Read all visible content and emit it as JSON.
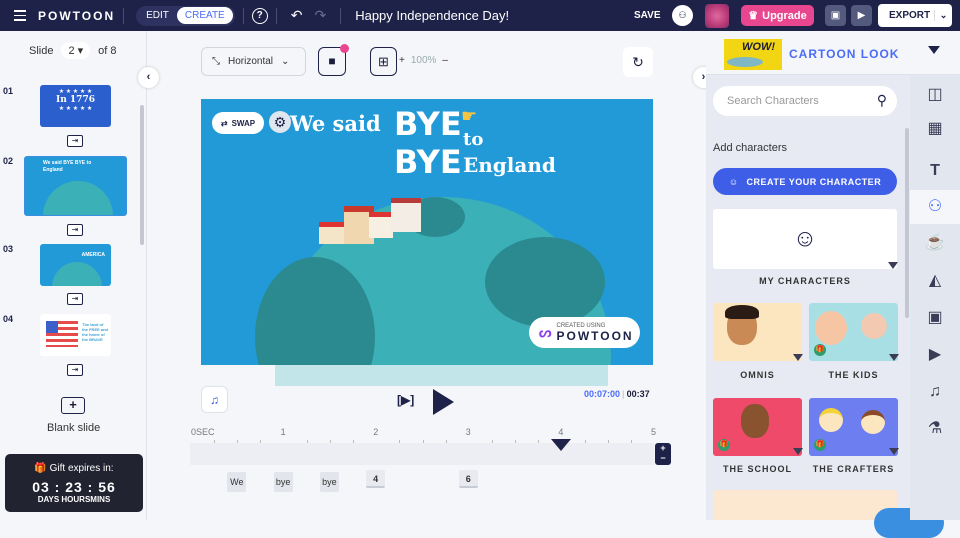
{
  "topbar": {
    "logo": "POWTOON",
    "modes": [
      "EDIT",
      "CREATE"
    ],
    "active_mode": "CREATE",
    "help_icon": "?",
    "undo_icon": "↶",
    "redo_icon": "↷",
    "title": "Happy Independence Day!",
    "save_label": "SAVE",
    "add_user_icon": "person-plus",
    "upgrade_label": "Upgrade",
    "upgrade_icon": "♛",
    "presentation_icon": "▣",
    "play_icon": "▶",
    "export_label": "EXPORT",
    "export_dropdown_icon": "⌄",
    "colors": {
      "bar": "#1e2248",
      "upgrade": "#e8468f",
      "accent": "#4a6cf7"
    }
  },
  "slides_panel": {
    "slide_label": "Slide",
    "current_slide": "2",
    "of_label": "of 8",
    "slides": [
      {
        "number": "01",
        "title": "In 1776"
      },
      {
        "number": "02",
        "title": "We said BYE BYE to England"
      },
      {
        "number": "03",
        "title": "AMERICA"
      },
      {
        "number": "04",
        "title": "The land of the FREE and the home of the BRAVE"
      }
    ],
    "transition_icon": "⇥",
    "blank_slide_icon": "+",
    "blank_slide_label": "Blank slide",
    "gift": {
      "label": "Gift expires in:",
      "countdown": "03 : 23 : 56",
      "units": "DAYS HOURSMINS"
    }
  },
  "canvas_toolbar": {
    "orientation": "Horizontal",
    "zoom_plus": "+",
    "zoom_level": "100%",
    "zoom_minus": "–"
  },
  "slide": {
    "swap_label": "SWAP",
    "line1": "We said",
    "bye1": "BYE",
    "bye2": "BYE",
    "to": "to",
    "england": "England",
    "created_using": "CREATED USING",
    "brand": "POWTOON"
  },
  "playback": {
    "preview_label": "[▶]",
    "current_time": "00:07:00",
    "total_time": "00:37"
  },
  "timeline": {
    "ticks": [
      "0SEC",
      "1",
      "2",
      "3",
      "4",
      "5"
    ],
    "playhead_seconds": 4.0,
    "zoom_in": "+",
    "zoom_out": "−",
    "chips": [
      {
        "label": "We",
        "seconds": 0.5
      },
      {
        "label": "bye",
        "seconds": 1.0
      },
      {
        "label": "bye",
        "seconds": 1.5
      },
      {
        "label": "4",
        "seconds": 2.0
      },
      {
        "label": "6",
        "seconds": 3.0
      }
    ]
  },
  "right_panel": {
    "look_label": "CARTOON LOOK",
    "look_thumb_text": "WOW!",
    "search_placeholder": "Search Characters",
    "add_characters_label": "Add characters",
    "create_character_label": "CREATE YOUR CHARACTER",
    "my_characters_label": "MY CHARACTERS",
    "categories": [
      {
        "label": "OMNIS",
        "color": "#fbe6c0",
        "premium": false
      },
      {
        "label": "THE KIDS",
        "color": "#a8dfe4",
        "premium": true
      },
      {
        "label": "THE SCHOOL",
        "color": "#ef4a6a",
        "premium": true
      },
      {
        "label": "THE CRAFTERS",
        "color": "#6c7ef0",
        "premium": true
      }
    ],
    "sidebar_icons": [
      "layout-icon",
      "background-icon",
      "text-icon",
      "characters-icon",
      "props-icon",
      "shapes-icon",
      "media-icon",
      "video-icon",
      "audio-icon",
      "magic-icon"
    ],
    "active_sidebar_icon": "characters-icon"
  }
}
